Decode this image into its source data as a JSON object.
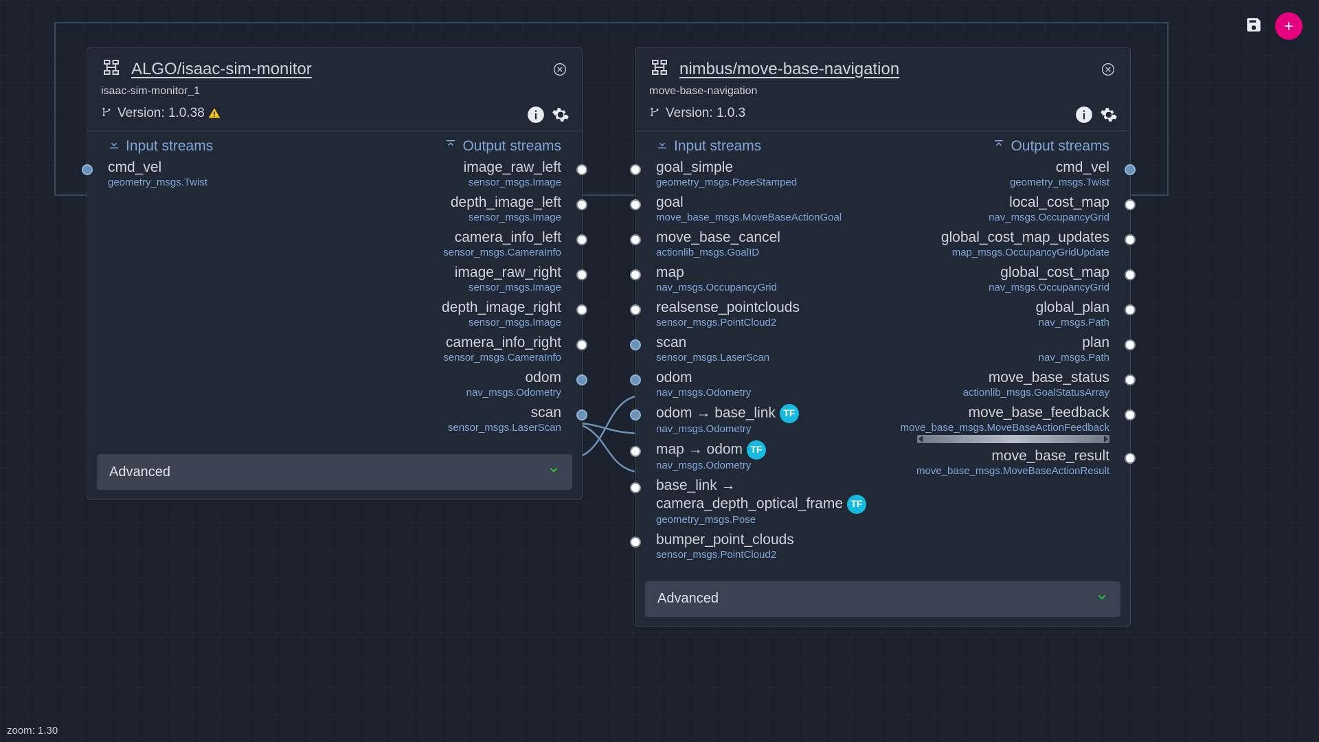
{
  "zoom_label": "zoom: 1.30",
  "toolbar": {
    "save": "save-icon",
    "add": "add-button"
  },
  "labels": {
    "input_streams": "Input streams",
    "output_streams": "Output streams",
    "advanced": "Advanced",
    "version_prefix": "Version: ",
    "tf_badge": "TF"
  },
  "nodes": [
    {
      "id": "isaac",
      "title": "ALGO/isaac-sim-monitor",
      "subtitle": "isaac-sim-monitor_1",
      "version": "1.0.38",
      "has_warning": true,
      "inputs": [
        {
          "name": "cmd_vel",
          "type": "geometry_msgs.Twist",
          "connected": true
        }
      ],
      "outputs": [
        {
          "name": "image_raw_left",
          "type": "sensor_msgs.Image",
          "connected": false
        },
        {
          "name": "depth_image_left",
          "type": "sensor_msgs.Image",
          "connected": false
        },
        {
          "name": "camera_info_left",
          "type": "sensor_msgs.CameraInfo",
          "connected": false
        },
        {
          "name": "image_raw_right",
          "type": "sensor_msgs.Image",
          "connected": false
        },
        {
          "name": "depth_image_right",
          "type": "sensor_msgs.Image",
          "connected": false
        },
        {
          "name": "camera_info_right",
          "type": "sensor_msgs.CameraInfo",
          "connected": false
        },
        {
          "name": "odom",
          "type": "nav_msgs.Odometry",
          "connected": true
        },
        {
          "name": "scan",
          "type": "sensor_msgs.LaserScan",
          "connected": true
        }
      ]
    },
    {
      "id": "movebase",
      "title": "nimbus/move-base-navigation",
      "subtitle": "move-base-navigation",
      "version": "1.0.3",
      "has_warning": false,
      "inputs": [
        {
          "name": "goal_simple",
          "type": "geometry_msgs.PoseStamped",
          "connected": false
        },
        {
          "name": "goal",
          "type": "move_base_msgs.MoveBaseActionGoal",
          "connected": false
        },
        {
          "name": "move_base_cancel",
          "type": "actionlib_msgs.GoalID",
          "connected": false
        },
        {
          "name": "map",
          "type": "nav_msgs.OccupancyGrid",
          "connected": false
        },
        {
          "name": "realsense_pointclouds",
          "type": "sensor_msgs.PointCloud2",
          "connected": false
        },
        {
          "name": "scan",
          "type": "sensor_msgs.LaserScan",
          "connected": true
        },
        {
          "name": "odom",
          "type": "nav_msgs.Odometry",
          "connected": true
        },
        {
          "name": "odom  →  base_link",
          "type": "nav_msgs.Odometry",
          "tf": true,
          "connected": true
        },
        {
          "name": "map  →  odom",
          "type": "nav_msgs.Odometry",
          "tf": true,
          "connected": false
        },
        {
          "name": "base_link  →  camera_depth_optical_frame",
          "type": "geometry_msgs.Pose",
          "tf": true,
          "connected": false,
          "multiline": true
        },
        {
          "name": "bumper_point_clouds",
          "type": "sensor_msgs.PointCloud2",
          "connected": false
        }
      ],
      "outputs": [
        {
          "name": "cmd_vel",
          "type": "geometry_msgs.Twist",
          "connected": true
        },
        {
          "name": "local_cost_map",
          "type": "nav_msgs.OccupancyGrid",
          "connected": false
        },
        {
          "name": "global_cost_map_updates",
          "type": "map_msgs.OccupancyGridUpdate",
          "connected": false
        },
        {
          "name": "global_cost_map",
          "type": "nav_msgs.OccupancyGrid",
          "connected": false
        },
        {
          "name": "global_plan",
          "type": "nav_msgs.Path",
          "connected": false
        },
        {
          "name": "plan",
          "type": "nav_msgs.Path",
          "connected": false
        },
        {
          "name": "move_base_status",
          "type": "actionlib_msgs.GoalStatusArray",
          "connected": false
        },
        {
          "name": "move_base_feedback",
          "type": "move_base_msgs.MoveBaseActionFeedback",
          "connected": false,
          "scrollhint": true
        },
        {
          "name": "move_base_result",
          "type": "move_base_msgs.MoveBaseActionResult",
          "connected": false
        }
      ]
    }
  ],
  "connections": [
    {
      "from": [
        "isaac",
        "out",
        "odom"
      ],
      "to": [
        "movebase",
        "in",
        "odom"
      ]
    },
    {
      "from": [
        "isaac",
        "out",
        "odom"
      ],
      "to": [
        "movebase",
        "in",
        "odom  →  base_link"
      ]
    },
    {
      "from": [
        "isaac",
        "out",
        "scan"
      ],
      "to": [
        "movebase",
        "in",
        "scan"
      ]
    },
    {
      "from": [
        "movebase",
        "out",
        "cmd_vel"
      ],
      "to": [
        "isaac",
        "in",
        "cmd_vel"
      ]
    }
  ]
}
